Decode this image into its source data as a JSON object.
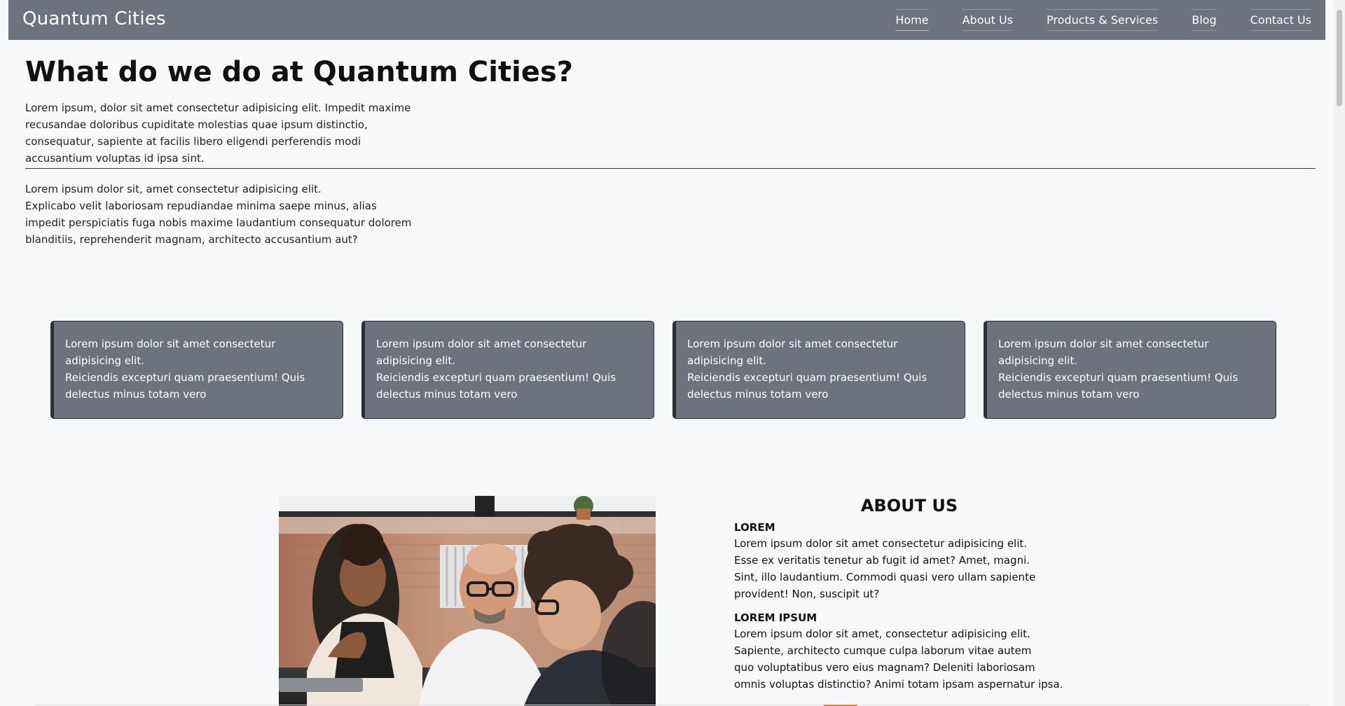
{
  "nav": {
    "brand": "Quantum Cities",
    "links": [
      {
        "label": "Home",
        "active": true
      },
      {
        "label": "About Us"
      },
      {
        "label": "Products & Services"
      },
      {
        "label": "Blog"
      },
      {
        "label": "Contact Us"
      }
    ]
  },
  "intro": {
    "title": "What do we do at Quantum Cities?",
    "paragraph1": "Lorem ipsum, dolor sit amet consectetur adipisicing elit. Impedit maxime recusandae doloribus cupiditate molestias quae ipsum distinctio, consequatur, sapiente at facilis libero eligendi perferendis modi accusantium voluptas id ipsa sint.",
    "paragraph2_line1": "Lorem ipsum dolor sit, amet consectetur adipisicing elit.",
    "paragraph2_line2": "Explicabo velit laboriosam repudiandae minima saepe minus, alias impedit perspiciatis fuga nobis maxime laudantium consequatur dolorem blanditiis, reprehenderit magnam, architecto accusantium aut?"
  },
  "cards": [
    {
      "line1": "Lorem ipsum dolor sit amet consectetur adipisicing elit.",
      "line2": "Reiciendis excepturi quam praesentium! Quis delectus minus totam vero"
    },
    {
      "line1": "Lorem ipsum dolor sit amet consectetur adipisicing elit.",
      "line2": "Reiciendis excepturi quam praesentium! Quis delectus minus totam vero"
    },
    {
      "line1": "Lorem ipsum dolor sit amet consectetur adipisicing elit.",
      "line2": "Reiciendis excepturi quam praesentium! Quis delectus minus totam vero"
    },
    {
      "line1": "Lorem ipsum dolor sit amet consectetur adipisicing elit.",
      "line2": "Reiciendis excepturi quam praesentium! Quis delectus minus totam vero"
    }
  ],
  "about": {
    "title": "ABOUT US",
    "section1": {
      "heading": "LOREM",
      "lines": [
        "Lorem ipsum dolor sit amet consectetur adipisicing elit.",
        "Esse ex veritatis tenetur ab fugit id amet? Amet, magni.",
        "Sint, illo laudantium. Commodi quasi vero ullam sapiente",
        "provident! Non, suscipit ut?"
      ]
    },
    "section2": {
      "heading": "LOREM IPSUM",
      "lines": [
        "Lorem ipsum dolor sit amet, consectetur adipisicing elit.",
        "Sapiente, architecto cumque culpa laborum vitae autem",
        "quo voluptatibus vero eius magnam? Deleniti laboriosam",
        "omnis voluptas distinctio? Animi totam ipsam aspernatur ipsa."
      ]
    }
  },
  "colors": {
    "navbar": "#6c737d",
    "card": "#6c737d",
    "card_border": "#2c2f33",
    "background": "#f7f8fa"
  },
  "photo": {
    "icon": "team-meeting-photo"
  }
}
